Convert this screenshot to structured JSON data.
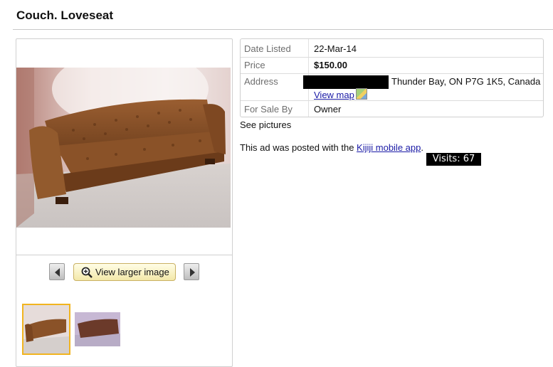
{
  "ad": {
    "title": "Couch. Loveseat"
  },
  "gallery": {
    "larger_label": "View larger image",
    "main_image_alt": "Brown tufted couch",
    "thumbnails": [
      "thumbnail 1",
      "thumbnail 2"
    ]
  },
  "details": {
    "rows": [
      {
        "label": "Date Listed",
        "value": "22-Mar-14"
      },
      {
        "label": "Price",
        "value": "$150.00"
      },
      {
        "label": "Address",
        "value": "Thunder Bay, ON P7G 1K5, Canada",
        "link": "View map"
      },
      {
        "label": "For Sale By",
        "value": "Owner"
      }
    ]
  },
  "description": {
    "line1": "See pictures",
    "posted_prefix": "This ad was posted with the ",
    "posted_link": "Kijiji mobile app",
    "posted_suffix": "."
  },
  "visits": "Visits: 67",
  "colors": {
    "thumb_border": "#f1b41f",
    "link": "#1a1aa6",
    "button_bg": "#f3e8a9"
  }
}
